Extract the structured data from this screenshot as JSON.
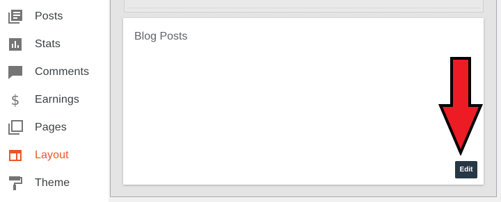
{
  "sidebar": {
    "items": [
      {
        "label": "Posts",
        "icon": "posts-icon"
      },
      {
        "label": "Stats",
        "icon": "stats-icon"
      },
      {
        "label": "Comments",
        "icon": "comments-icon"
      },
      {
        "label": "Earnings",
        "icon": "dollar-icon"
      },
      {
        "label": "Pages",
        "icon": "pages-icon"
      },
      {
        "label": "Layout",
        "icon": "layout-icon",
        "active": true
      },
      {
        "label": "Theme",
        "icon": "paint-roller-icon"
      }
    ],
    "colors": {
      "icon": "#757575",
      "active": "#e8572b",
      "label": "#3c4043"
    }
  },
  "main": {
    "widget": {
      "title": "Blog Posts",
      "edit_label": "Edit"
    },
    "annotation": {
      "color": "#ed1c24",
      "outline": "#000000"
    }
  }
}
